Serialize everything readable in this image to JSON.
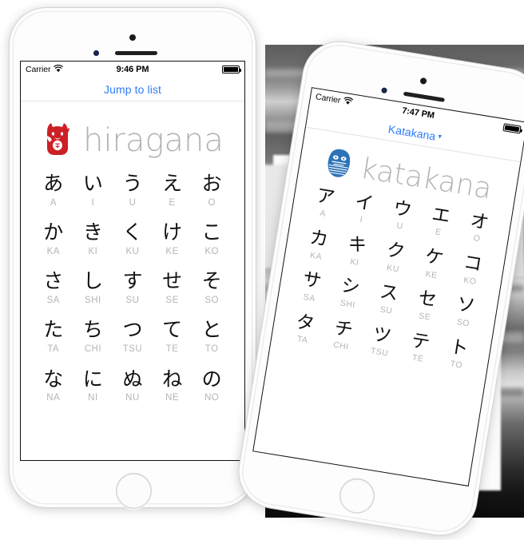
{
  "left_phone": {
    "device": "iPhone",
    "status_bar": {
      "carrier": "Carrier",
      "wifi_icon": "wifi-icon",
      "time": "9:46 PM",
      "battery_icon": "battery-full-icon"
    },
    "nav": {
      "title": "Jump to list",
      "has_caret": false,
      "accent": "#2f7ef7"
    },
    "logo": {
      "icon": "maneki-neko-icon",
      "icon_color": "#cc2027",
      "word": "hiragana",
      "word_color": "#b3b3b3"
    },
    "grid": {
      "rows": [
        {
          "chars": [
            "あ",
            "い",
            "う",
            "え",
            "お"
          ],
          "romaji": [
            "A",
            "I",
            "U",
            "E",
            "O"
          ]
        },
        {
          "chars": [
            "か",
            "き",
            "く",
            "け",
            "こ"
          ],
          "romaji": [
            "KA",
            "KI",
            "KU",
            "KE",
            "KO"
          ]
        },
        {
          "chars": [
            "さ",
            "し",
            "す",
            "せ",
            "そ"
          ],
          "romaji": [
            "SA",
            "SHI",
            "SU",
            "SE",
            "SO"
          ]
        },
        {
          "chars": [
            "た",
            "ち",
            "つ",
            "て",
            "と"
          ],
          "romaji": [
            "TA",
            "CHI",
            "TSU",
            "TE",
            "TO"
          ]
        },
        {
          "chars": [
            "な",
            "に",
            "ぬ",
            "ね",
            "の"
          ],
          "romaji": [
            "NA",
            "NI",
            "NU",
            "NE",
            "NO"
          ]
        }
      ]
    }
  },
  "right_phone": {
    "device": "iPhone",
    "status_bar": {
      "carrier": "Carrier",
      "wifi_icon": "wifi-icon",
      "time": "7:47 PM",
      "battery_icon": "battery-full-icon"
    },
    "nav": {
      "title": "Katakana",
      "caret": "▾",
      "has_caret": true,
      "accent": "#2f7ef7"
    },
    "logo": {
      "icon": "daruma-icon",
      "icon_color": "#2e73b8",
      "word": "katakana",
      "word_color": "#b3b3b3"
    },
    "grid": {
      "rows": [
        {
          "chars": [
            "ア",
            "イ",
            "ウ",
            "エ",
            "オ"
          ],
          "romaji": [
            "A",
            "I",
            "U",
            "E",
            "O"
          ]
        },
        {
          "chars": [
            "カ",
            "キ",
            "ク",
            "ケ",
            "コ"
          ],
          "romaji": [
            "KA",
            "KI",
            "KU",
            "KE",
            "KO"
          ]
        },
        {
          "chars": [
            "サ",
            "シ",
            "ス",
            "セ",
            "ソ"
          ],
          "romaji": [
            "SA",
            "SHI",
            "SU",
            "SE",
            "SO"
          ]
        },
        {
          "chars": [
            "タ",
            "チ",
            "ツ",
            "テ",
            "ト"
          ],
          "romaji": [
            "TA",
            "CHI",
            "TSU",
            "TE",
            "TO"
          ]
        }
      ]
    }
  }
}
